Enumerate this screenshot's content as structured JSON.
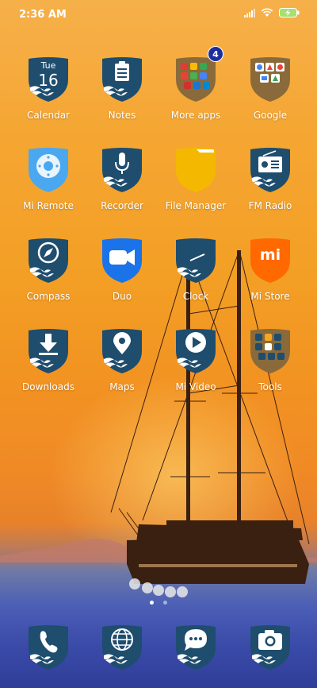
{
  "status": {
    "time": "2:36 AM",
    "icons": [
      "signal-icon",
      "wifi-icon",
      "battery-charging-icon"
    ]
  },
  "calendar": {
    "weekday": "Tue",
    "day": "16"
  },
  "apps": [
    {
      "label": "Calendar",
      "icon": "calendar-icon"
    },
    {
      "label": "Notes",
      "icon": "notes-icon"
    },
    {
      "label": "More apps",
      "icon": "folder-icon",
      "badge": "4"
    },
    {
      "label": "Google",
      "icon": "folder-icon"
    },
    {
      "label": "Mi Remote",
      "icon": "remote-icon"
    },
    {
      "label": "Recorder",
      "icon": "microphone-icon"
    },
    {
      "label": "File Manager",
      "icon": "folder-icon"
    },
    {
      "label": "FM Radio",
      "icon": "radio-icon"
    },
    {
      "label": "Compass",
      "icon": "compass-icon"
    },
    {
      "label": "Duo",
      "icon": "video-camera-icon"
    },
    {
      "label": "Clock",
      "icon": "clock-icon"
    },
    {
      "label": "Mi Store",
      "icon": "mi-logo-icon"
    },
    {
      "label": "Downloads",
      "icon": "download-icon"
    },
    {
      "label": "Maps",
      "icon": "map-pin-icon"
    },
    {
      "label": "Mi Video",
      "icon": "play-icon"
    },
    {
      "label": "Tools",
      "icon": "folder-icon"
    }
  ],
  "dock": [
    {
      "icon": "phone-icon"
    },
    {
      "icon": "browser-globe-icon"
    },
    {
      "icon": "messages-icon"
    },
    {
      "icon": "camera-icon"
    }
  ],
  "pages": {
    "count": 2,
    "active": 1
  },
  "mi_logo_text": "mi",
  "colors": {
    "shield": "#1e4d6e",
    "wave": "#ffffff",
    "badge": "#1d2d9c",
    "duo": "#1a73e8",
    "mi_store": "#ff6900",
    "file_manager": "#f5b800",
    "mi_remote": "#4aa8f0"
  }
}
